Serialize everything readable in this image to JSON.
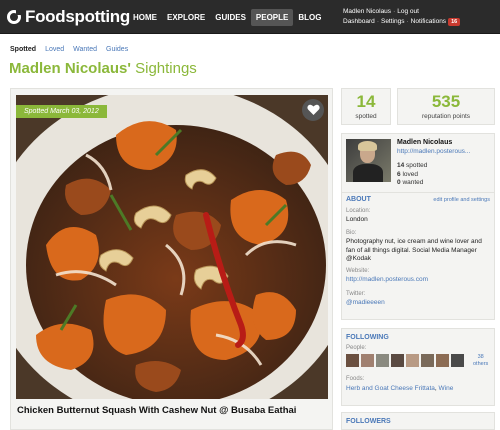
{
  "header": {
    "logo_text": "Foodspotting",
    "nav": [
      {
        "label": "HOME",
        "active": false
      },
      {
        "label": "EXPLORE",
        "active": false
      },
      {
        "label": "GUIDES",
        "active": false
      },
      {
        "label": "PEOPLE",
        "active": true
      },
      {
        "label": "BLOG",
        "active": false
      }
    ],
    "user": {
      "name": "Madlen Nicolaus",
      "logout": "Log out",
      "dashboard": "Dashboard",
      "settings": "Settings",
      "notifications": "Notifications",
      "notification_count": "16"
    }
  },
  "tabs": [
    "Spotted",
    "Loved",
    "Wanted",
    "Guides"
  ],
  "page_title": {
    "name": "Madlen Nicolaus'",
    "rest": " Sightings"
  },
  "sighting": {
    "spotted_date": "Spotted March 03, 2012",
    "title": "Chicken Butternut Squash With Cashew Nut @ Busaba Eathai"
  },
  "stats": [
    {
      "value": "14",
      "label": "spotted"
    },
    {
      "value": "535",
      "label": "reputation points"
    }
  ],
  "profile": {
    "name": "Madlen Nicolaus",
    "url": "http://madlen.posterous...",
    "spotted": "14",
    "spotted_label": "spotted",
    "loved": "6",
    "loved_label": "loved",
    "wanted": "0",
    "wanted_label": "wanted",
    "about_title": "ABOUT",
    "edit_label": "edit profile and settings",
    "location_label": "Location:",
    "location": "London",
    "bio_label": "Bio:",
    "bio": "Photography nut, ice cream and wine lover and fan of all things digital. Social Media Manager @Kodak",
    "website_label": "Website:",
    "website": "http://madlen.posterous.com",
    "twitter_label": "Twitter:",
    "twitter": "@madieeeen"
  },
  "following": {
    "title": "FOLLOWING",
    "people_label": "People:",
    "others_count": "38",
    "others_label": "others",
    "foods_label": "Foods:",
    "foods": [
      "Herb and Goat Cheese Frittata",
      "Wine"
    ]
  },
  "followers": {
    "title": "FOLLOWERS"
  },
  "colors": {
    "accent": "#8bb83a",
    "link": "#4a78b8",
    "nav_bg": "#2b2b2b",
    "badge": "#c83a2f"
  }
}
